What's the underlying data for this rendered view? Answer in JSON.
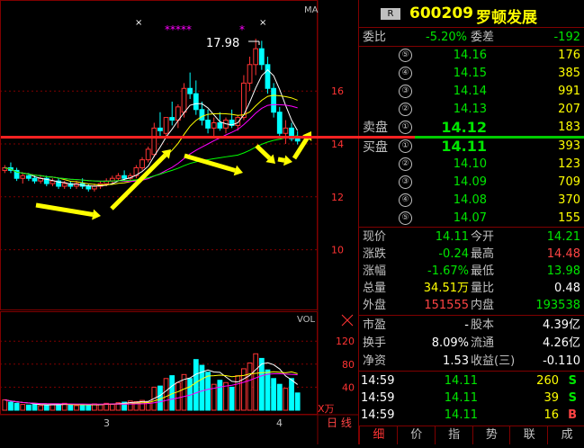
{
  "chart_data": {
    "type": "candlestick",
    "price_axis": {
      "ticks": [
        "16",
        "14",
        "12",
        "10"
      ]
    },
    "label_ma": "MA",
    "peak_label": "17.98",
    "stars": "*****",
    "star_single": "*",
    "x_label_mark": "×",
    "x_ticks": [
      "3",
      "4"
    ],
    "volume": {
      "label": "VOL",
      "ticks": [
        "120",
        "80",
        "40"
      ],
      "unit": "X万",
      "values": [
        18,
        14,
        12,
        10,
        9,
        10,
        8,
        9,
        11,
        10,
        12,
        9,
        8,
        10,
        9,
        11,
        10,
        12,
        11,
        13,
        14,
        16,
        15,
        17,
        14,
        40,
        42,
        55,
        60,
        48,
        62,
        55,
        88,
        78,
        66,
        45,
        52,
        48,
        40,
        60,
        72,
        82,
        98,
        90,
        70,
        55,
        45,
        38,
        55,
        30
      ]
    },
    "candles": [
      [
        13.0,
        13.2,
        12.9,
        13.1
      ],
      [
        13.1,
        13.3,
        12.9,
        13.0
      ],
      [
        13.0,
        13.1,
        12.6,
        12.7
      ],
      [
        12.7,
        12.9,
        12.5,
        12.8
      ],
      [
        12.8,
        12.9,
        12.6,
        12.7
      ],
      [
        12.7,
        12.8,
        12.5,
        12.6
      ],
      [
        12.6,
        12.8,
        12.5,
        12.7
      ],
      [
        12.7,
        12.8,
        12.4,
        12.5
      ],
      [
        12.5,
        12.7,
        12.4,
        12.6
      ],
      [
        12.6,
        12.7,
        12.3,
        12.4
      ],
      [
        12.4,
        12.6,
        12.3,
        12.5
      ],
      [
        12.5,
        12.6,
        12.3,
        12.4
      ],
      [
        12.4,
        12.6,
        12.3,
        12.5
      ],
      [
        12.5,
        12.7,
        12.3,
        12.4
      ],
      [
        12.4,
        12.5,
        12.2,
        12.3
      ],
      [
        12.3,
        12.5,
        12.2,
        12.4
      ],
      [
        12.4,
        12.6,
        12.3,
        12.5
      ],
      [
        12.5,
        12.7,
        12.4,
        12.6
      ],
      [
        12.6,
        12.8,
        12.5,
        12.7
      ],
      [
        12.7,
        12.9,
        12.6,
        12.8
      ],
      [
        12.8,
        13.0,
        12.6,
        12.7
      ],
      [
        12.7,
        12.9,
        12.6,
        12.8
      ],
      [
        12.8,
        13.2,
        12.7,
        13.1
      ],
      [
        13.1,
        13.5,
        13.0,
        13.4
      ],
      [
        13.4,
        13.9,
        13.3,
        13.8
      ],
      [
        13.6,
        14.8,
        13.5,
        14.6
      ],
      [
        14.6,
        15.2,
        14.3,
        14.5
      ],
      [
        14.4,
        15.0,
        14.2,
        15.0
      ],
      [
        15.0,
        15.6,
        14.7,
        14.9
      ],
      [
        14.9,
        15.5,
        14.6,
        15.4
      ],
      [
        15.2,
        16.3,
        15.0,
        16.1
      ],
      [
        16.1,
        16.7,
        15.7,
        15.9
      ],
      [
        15.9,
        16.4,
        15.1,
        15.3
      ],
      [
        15.3,
        15.6,
        14.7,
        14.9
      ],
      [
        14.9,
        15.3,
        14.4,
        14.6
      ],
      [
        14.6,
        15.0,
        14.3,
        14.8
      ],
      [
        14.8,
        15.2,
        14.5,
        14.6
      ],
      [
        14.6,
        15.0,
        14.4,
        14.9
      ],
      [
        14.9,
        15.3,
        14.6,
        14.7
      ],
      [
        14.7,
        15.1,
        14.5,
        15.0
      ],
      [
        15.0,
        16.6,
        14.9,
        16.3
      ],
      [
        16.3,
        17.3,
        16.0,
        17.0
      ],
      [
        17.0,
        17.98,
        16.6,
        17.6
      ],
      [
        17.6,
        17.9,
        16.8,
        17.0
      ],
      [
        17.0,
        17.3,
        15.9,
        16.1
      ],
      [
        16.1,
        16.3,
        15.0,
        15.2
      ],
      [
        15.2,
        15.4,
        14.3,
        14.4
      ],
      [
        14.4,
        14.9,
        14.0,
        14.6
      ],
      [
        14.6,
        14.8,
        14.1,
        14.2
      ],
      [
        14.21,
        14.48,
        13.98,
        14.11
      ]
    ]
  },
  "header": {
    "badge": "R",
    "code": "600209",
    "name": "罗顿发展"
  },
  "order_book": {
    "weibi_label": "委比",
    "weibi_value": "-5.20%",
    "weicha_label": "委差",
    "weicha_value": "-192",
    "sell_label": "卖盘",
    "buy_label": "买盘",
    "sells": [
      {
        "level": "⑤",
        "price": "14.16",
        "volume": "176"
      },
      {
        "level": "④",
        "price": "14.15",
        "volume": "385"
      },
      {
        "level": "③",
        "price": "14.14",
        "volume": "991"
      },
      {
        "level": "②",
        "price": "14.13",
        "volume": "207"
      },
      {
        "level": "①",
        "price": "14.12",
        "volume": "183"
      }
    ],
    "buys": [
      {
        "level": "①",
        "price": "14.11",
        "volume": "393"
      },
      {
        "level": "②",
        "price": "14.10",
        "volume": "123"
      },
      {
        "level": "③",
        "price": "14.09",
        "volume": "709"
      },
      {
        "level": "④",
        "price": "14.08",
        "volume": "370"
      },
      {
        "level": "⑤",
        "price": "14.07",
        "volume": "155"
      }
    ]
  },
  "stats": {
    "rows": [
      {
        "l1": "现价",
        "v1": "14.11",
        "c1": "green",
        "l2": "今开",
        "v2": "14.21",
        "c2": "green"
      },
      {
        "l1": "涨跌",
        "v1": "-0.24",
        "c1": "green",
        "l2": "最高",
        "v2": "14.48",
        "c2": "red"
      },
      {
        "l1": "涨幅",
        "v1": "-1.67%",
        "c1": "green",
        "l2": "最低",
        "v2": "13.98",
        "c2": "green"
      },
      {
        "l1": "总量",
        "v1": "34.51万",
        "c1": "yellow",
        "l2": "量比",
        "v2": "0.48",
        "c2": "white"
      },
      {
        "l1": "外盘",
        "v1": "151555",
        "c1": "red",
        "l2": "内盘",
        "v2": "193538",
        "c2": "green"
      }
    ],
    "rows2": [
      {
        "l1": "市盈",
        "v1": "-",
        "l2": "股本",
        "v2": "4.39亿"
      },
      {
        "l1": "换手",
        "v1": "8.09%",
        "l2": "流通",
        "v2": "4.26亿"
      },
      {
        "l1": "净资",
        "v1": "1.53",
        "l2": "收益(三)",
        "v2": "-0.110"
      }
    ]
  },
  "ticks": [
    {
      "time": "14:59",
      "price": "14.11",
      "vol": "260",
      "side": "S",
      "side_color": "green"
    },
    {
      "time": "14:59",
      "price": "14.11",
      "vol": "39",
      "side": "S",
      "side_color": "green"
    },
    {
      "time": "14:59",
      "price": "14.11",
      "vol": "16",
      "side": "B",
      "side_color": "red"
    }
  ],
  "bottom_tabs": [
    "细",
    "价",
    "指",
    "势",
    "联",
    "成"
  ],
  "side_tab": "日 线",
  "colors": {
    "up": "#ff3333",
    "down": "#00ffff",
    "ma5": "#ffffff",
    "ma10": "#ffff00",
    "ma20": "#ff00ff",
    "ma60": "#00ff00",
    "frame": "#7f0000",
    "arrow": "#ffff00"
  }
}
